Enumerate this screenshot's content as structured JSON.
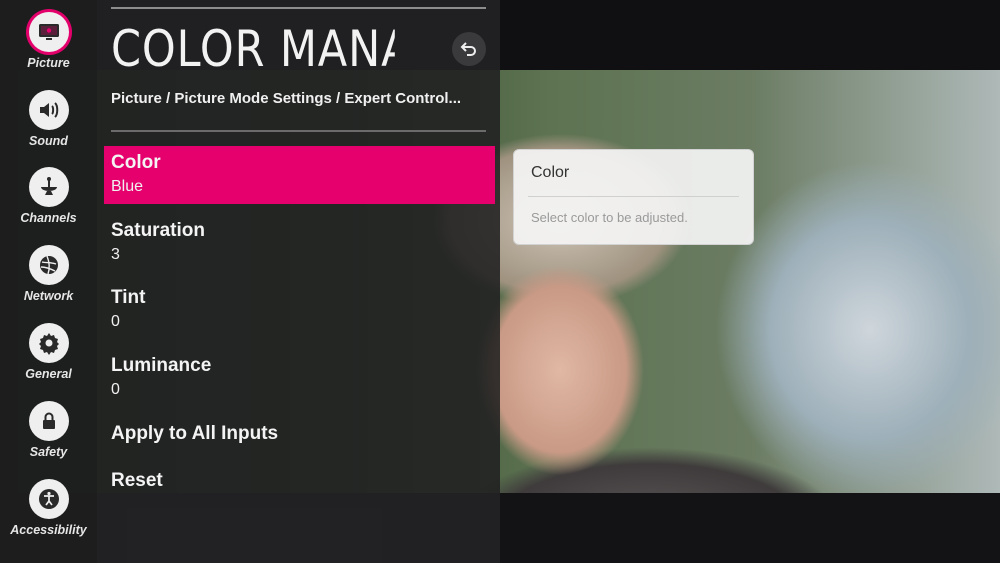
{
  "sidebar": {
    "items": [
      {
        "label": "Picture",
        "icon": "picture-icon",
        "active": true
      },
      {
        "label": "Sound",
        "icon": "speaker-icon"
      },
      {
        "label": "Channels",
        "icon": "satellite-dish-icon"
      },
      {
        "label": "Network",
        "icon": "globe-icon"
      },
      {
        "label": "General",
        "icon": "gear-icon"
      },
      {
        "label": "Safety",
        "icon": "lock-icon"
      },
      {
        "label": "Accessibility",
        "icon": "accessibility-icon"
      }
    ]
  },
  "panel": {
    "title": "COLOR MANA...",
    "back_icon": "back-arrow-icon",
    "breadcrumb": "Picture / Picture Mode Settings / Expert Control...",
    "items": [
      {
        "label": "Color",
        "value": "Blue",
        "selected": true
      },
      {
        "label": "Saturation",
        "value": "3"
      },
      {
        "label": "Tint",
        "value": "0"
      },
      {
        "label": "Luminance",
        "value": "0"
      },
      {
        "label": "Apply to All Inputs"
      },
      {
        "label": "Reset"
      }
    ]
  },
  "tooltip": {
    "title": "Color",
    "text": "Select color to be adjusted."
  },
  "colors": {
    "accent": "#e6006e",
    "panel_bg": "#28282a",
    "text": "#f2f2f2"
  }
}
